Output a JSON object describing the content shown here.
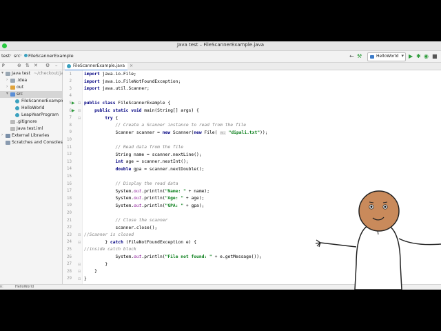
{
  "window": {
    "title": "Java test – FileScannerExample.java"
  },
  "navbar": {
    "breadcrumbs": [
      "test",
      "src",
      "FileScannerExample"
    ],
    "run_config": "HelloWorld"
  },
  "project_panel": {
    "label": "P",
    "tree": [
      {
        "label": "Java test",
        "hint": "~/checkout/java",
        "indent": 0,
        "arrow": "▾",
        "icon": "folder"
      },
      {
        "label": ".idea",
        "indent": 1,
        "arrow": "›",
        "icon": "folder"
      },
      {
        "label": "out",
        "indent": 1,
        "arrow": "›",
        "icon": "folder-orange"
      },
      {
        "label": "src",
        "indent": 1,
        "arrow": "▾",
        "icon": "folder-blue",
        "selected": true
      },
      {
        "label": "FileScannerExample",
        "indent": 2,
        "icon": "java"
      },
      {
        "label": "HelloWorld",
        "indent": 2,
        "icon": "java"
      },
      {
        "label": "LeapYearProgram",
        "indent": 2,
        "icon": "java"
      },
      {
        "label": ".gitignore",
        "indent": 1,
        "icon": "file"
      },
      {
        "label": "Java test.iml",
        "indent": 1,
        "icon": "file"
      },
      {
        "label": "External Libraries",
        "indent": 0,
        "arrow": "›",
        "icon": "lib"
      },
      {
        "label": "Scratches and Consoles",
        "indent": 0,
        "icon": "scratch"
      }
    ]
  },
  "editor": {
    "tab_label": "FileScannerExample.java",
    "line_numbers": [
      "1",
      "2",
      "3",
      "4",
      "5",
      "6",
      "7",
      "8",
      "9",
      "10",
      "11",
      "12",
      "13",
      "14",
      "15",
      "16",
      "17",
      "18",
      "19",
      "20",
      "21",
      "22",
      "23",
      "24",
      "25",
      "26",
      "27",
      "28",
      "29"
    ],
    "lines": [
      {
        "text": "import java.io.File;"
      },
      {
        "text": "import java.io.FileNotFoundException;"
      },
      {
        "text": "import java.util.Scanner;"
      },
      {
        "text": ""
      },
      {
        "text": "public class FileScannerExample {"
      },
      {
        "text": "    public static void main(String[] args) {"
      },
      {
        "text": "        try {"
      },
      {
        "text": "            // Create a Scanner instance to read from the file"
      },
      {
        "text": "            Scanner scanner = new Scanner(new File( \"dipali.txt\"));"
      },
      {
        "text": ""
      },
      {
        "text": "            // Read data from the file"
      },
      {
        "text": "            String name = scanner.nextLine();"
      },
      {
        "text": "            int age = scanner.nextInt();"
      },
      {
        "text": "            double gpa = scanner.nextDouble();"
      },
      {
        "text": ""
      },
      {
        "text": "            // Display the read data"
      },
      {
        "text": "            System.out.println(\"Name: \" + name);"
      },
      {
        "text": "            System.out.println(\"Age: \" + age);"
      },
      {
        "text": "            System.out.println(\"GPA: \" + gpa);"
      },
      {
        "text": ""
      },
      {
        "text": "            // Close the scanner"
      },
      {
        "text": "            scanner.close();"
      },
      {
        "text": "//Scanner is closed"
      },
      {
        "text": "        } catch (FileNotFoundException e) {"
      },
      {
        "text": "//inside catch block"
      },
      {
        "text": "            System.out.println(\"File not found: \" + e.getMessage());"
      },
      {
        "text": "        }"
      },
      {
        "text": "    }"
      },
      {
        "text": "}"
      }
    ],
    "param_hint": "n:"
  },
  "statusbar": {
    "left": "n:",
    "config": "HelloWorld"
  },
  "colors": {
    "keyword": "#000080",
    "comment": "#808080",
    "string": "#067d17",
    "field": "#871094",
    "run_green": "#2e9c3b",
    "selection": "#d5d5d5"
  }
}
